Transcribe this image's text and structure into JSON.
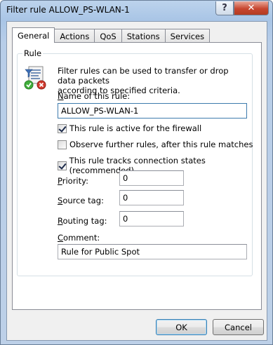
{
  "window": {
    "title": "Filter rule ALLOW_PS-WLAN-1",
    "help_glyph": "?",
    "close_glyph": "✕"
  },
  "tabs": [
    {
      "label": "General",
      "active": true
    },
    {
      "label": "Actions",
      "active": false
    },
    {
      "label": "QoS",
      "active": false
    },
    {
      "label": "Stations",
      "active": false
    },
    {
      "label": "Services",
      "active": false
    }
  ],
  "rule_group": {
    "title": "Rule",
    "info_line1": "Filter rules can be used to transfer or drop data packets",
    "info_line2": "according to specified criteria.",
    "info_icon": "filter-rule-icon"
  },
  "fields": {
    "name": {
      "label_u": "N",
      "label_rest": "ame of this rule:",
      "value": "ALLOW_PS-WLAN-1"
    },
    "priority": {
      "label_u": "P",
      "label_rest": "riority:",
      "value": "0"
    },
    "source_tag": {
      "label_u": "S",
      "label_rest": "ource tag:",
      "value": "0"
    },
    "routing_tag": {
      "label_u": "R",
      "label_rest": "outing tag:",
      "value": "0"
    },
    "comment": {
      "label_u": "C",
      "label_rest": "omment:",
      "value": "Rule for Public Spot"
    }
  },
  "checkboxes": [
    {
      "label": "This rule is active for the firewall",
      "checked": true
    },
    {
      "label": "Observe further rules, after this rule matches",
      "checked": false
    },
    {
      "label": "This rule tracks connection states (recommended)",
      "checked": true
    }
  ],
  "buttons": {
    "ok": "OK",
    "cancel": "Cancel"
  }
}
